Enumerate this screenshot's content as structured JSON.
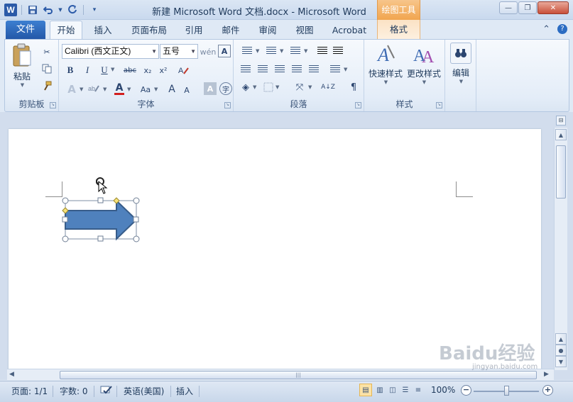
{
  "window": {
    "title": "新建 Microsoft Word 文档.docx - Microsoft Word",
    "context_group": "绘图工具",
    "minimize": "—",
    "restore": "❐",
    "close": "✕"
  },
  "qat": {
    "logo": "W",
    "save_icon": "save-icon",
    "undo_icon": "undo-icon",
    "redo_icon": "redo-icon",
    "customize_icon": "customize-icon"
  },
  "tabs": {
    "file": "文件",
    "home": "开始",
    "insert": "插入",
    "layout": "页面布局",
    "references": "引用",
    "mailings": "邮件",
    "review": "审阅",
    "view": "视图",
    "acrobat": "Acrobat",
    "format": "格式"
  },
  "ribbon": {
    "clipboard": {
      "label": "剪贴板",
      "paste": "粘贴"
    },
    "font": {
      "label": "字体",
      "font_name": "Calibri (西文正文)",
      "font_size": "五号",
      "bold": "B",
      "italic": "I",
      "underline": "U",
      "strike": "abc",
      "subscript": "x₂",
      "superscript": "x²",
      "grow": "A",
      "shrink": "A",
      "case": "Aa"
    },
    "paragraph": {
      "label": "段落"
    },
    "styles": {
      "label": "样式",
      "quick_styles": "快速样式",
      "change_styles": "更改样式"
    },
    "editing": {
      "label": "编辑",
      "edit": "编辑"
    }
  },
  "status": {
    "page": "页面: 1/1",
    "words": "字数: 0",
    "language": "英语(美国)",
    "insert_mode": "插入",
    "zoom": "100%"
  },
  "watermark": {
    "brand": "Baidu经验",
    "url": "jingyan.baidu.com"
  },
  "colors": {
    "ribbon_bg": "#e4edf8",
    "file_tab": "#2458a8",
    "context_orange": "#f1a54f",
    "shape_fill": "#4f81bd",
    "shape_border": "#385d8a"
  }
}
